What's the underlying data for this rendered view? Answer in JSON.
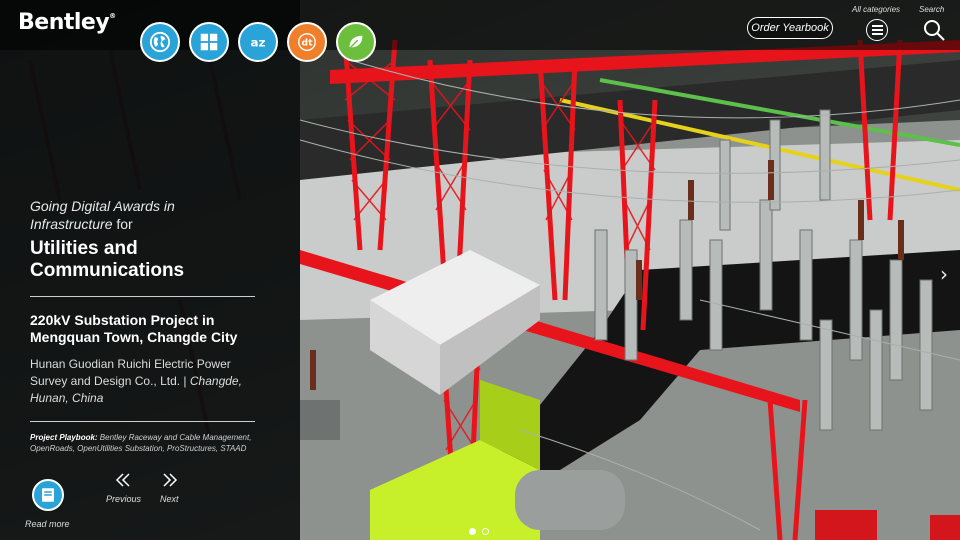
{
  "brand": {
    "logo_text": "Bentley",
    "logo_mark": "®"
  },
  "categories": [
    {
      "icon": "globe-icon",
      "color": "#29a3d8"
    },
    {
      "icon": "grid-icon",
      "color": "#29a3d8"
    },
    {
      "icon": "az-icon",
      "color": "#29a3d8",
      "glyph": "az"
    },
    {
      "icon": "dt-icon",
      "color": "#f07f2b",
      "glyph": "dt"
    },
    {
      "icon": "leaf-icon",
      "color": "#6cbf3c"
    }
  ],
  "header": {
    "order_button": "Order Yearbook",
    "all_categories_label": "All categories",
    "search_label": "Search"
  },
  "award": {
    "line1": "Going Digital Awards in",
    "line2_italic": "Infrastructure",
    "line2_rest": " for",
    "category": "Utilities and Communications"
  },
  "project": {
    "title": "220kV Substation Project in Mengquan Town, Changde City",
    "organization": "Hunan Guodian Ruichi Electric Power Survey and Design Co., Ltd.",
    "separator": " | ",
    "location": "Changde, Hunan, China",
    "playbook_label": "Project Playbook:",
    "playbook_products": " Bentley Raceway and Cable Management, OpenRoads, OpenUtilities Substation, ProStructures, STAAD"
  },
  "footer": {
    "read_more": "Read more",
    "previous": "Previous",
    "next": "Next"
  },
  "slides": {
    "count": 2,
    "active": 0
  },
  "colors": {
    "accent_blue": "#29a3d8",
    "accent_orange": "#f07f2b",
    "accent_green": "#6cbf3c",
    "steel_red": "#e8141c",
    "equipment_green": "#c8f02a"
  }
}
